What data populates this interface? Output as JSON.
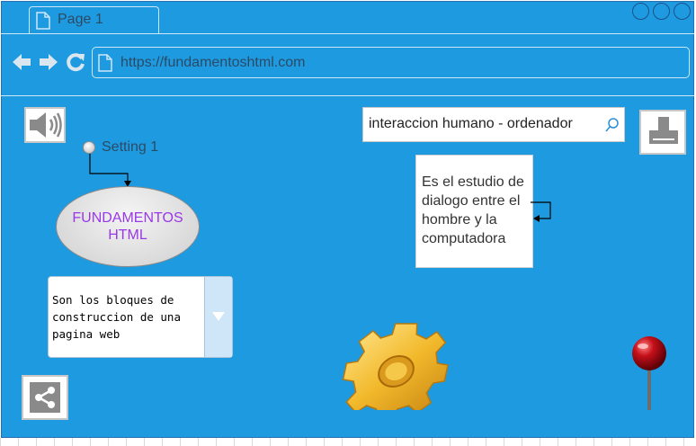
{
  "browser": {
    "tab_title": "Page 1",
    "url": "https://fundamentoshtml.com"
  },
  "setting": {
    "label": "Setting 1"
  },
  "ellipse": {
    "text": "FUNDAMENTOS\nHTML"
  },
  "dropdown": {
    "text": "Son los bloques de\n construccion de una\npagina web"
  },
  "search": {
    "query": "interaccion humano - ordenador"
  },
  "note": {
    "text": "Es el estudio de dialogo entre el hombre y la computadora"
  },
  "icons": {
    "back": "arrow-left-icon",
    "forward": "arrow-right-icon",
    "reload": "reload-icon",
    "speaker": "speaker-icon",
    "print": "printer-icon",
    "share": "share-icon",
    "gear": "gear-icon",
    "pin": "pin-icon",
    "search": "search-icon"
  },
  "colors": {
    "background": "#1e9be0",
    "ellipse_text": "#9a38e8"
  }
}
